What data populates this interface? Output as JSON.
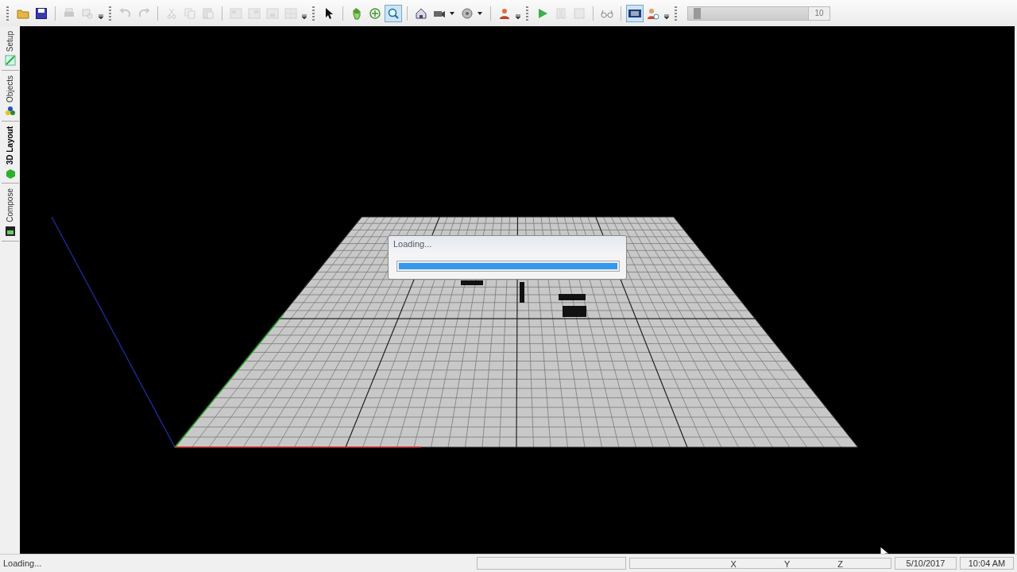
{
  "toolbar": {
    "groups": [
      {
        "buttons": [
          {
            "selected": false,
            "disabled": false
          },
          {
            "selected": false,
            "disabled": false
          },
          {
            "selected": false,
            "disabled": true
          },
          {
            "selected": false,
            "disabled": true
          }
        ]
      },
      {
        "buttons": [
          {
            "selected": false,
            "disabled": true
          },
          {
            "selected": false,
            "disabled": true
          },
          {
            "selected": false,
            "disabled": true
          },
          {
            "selected": false,
            "disabled": true
          },
          {
            "selected": false,
            "disabled": true
          },
          {
            "selected": false,
            "disabled": true
          },
          {
            "selected": false,
            "disabled": true
          },
          {
            "selected": false,
            "disabled": true
          },
          {
            "selected": false,
            "disabled": true
          }
        ]
      },
      {
        "buttons": [
          {
            "selected": false,
            "disabled": false
          },
          {
            "selected": false,
            "disabled": false
          },
          {
            "selected": false,
            "disabled": false
          },
          {
            "selected": true,
            "disabled": false
          },
          {
            "selected": false,
            "disabled": false
          },
          {
            "selected": false,
            "disabled": false
          },
          {
            "selected": false,
            "disabled": false
          },
          {
            "selected": false,
            "disabled": false
          }
        ]
      },
      {
        "buttons": [
          {
            "selected": false,
            "disabled": false
          },
          {
            "selected": false,
            "disabled": true
          },
          {
            "selected": false,
            "disabled": true
          },
          {
            "selected": false,
            "disabled": false
          },
          {
            "selected": true,
            "disabled": false
          },
          {
            "selected": false,
            "disabled": false
          }
        ]
      }
    ],
    "slider": {
      "level": 0.05,
      "reading": "10"
    }
  },
  "side_tabs": [
    {
      "label": "Setup",
      "selected": false
    },
    {
      "label": "Objects",
      "selected": false
    },
    {
      "label": "3D Layout",
      "selected": true
    },
    {
      "label": "Compose",
      "selected": false
    }
  ],
  "dialog": {
    "title": "Loading...",
    "progress": {
      "level": 1.0
    }
  },
  "status_bar": {
    "message": "Loading...",
    "axes": [
      "X",
      "Y",
      "Z"
    ],
    "date": "5/10/2017",
    "time": "10:04 AM"
  }
}
